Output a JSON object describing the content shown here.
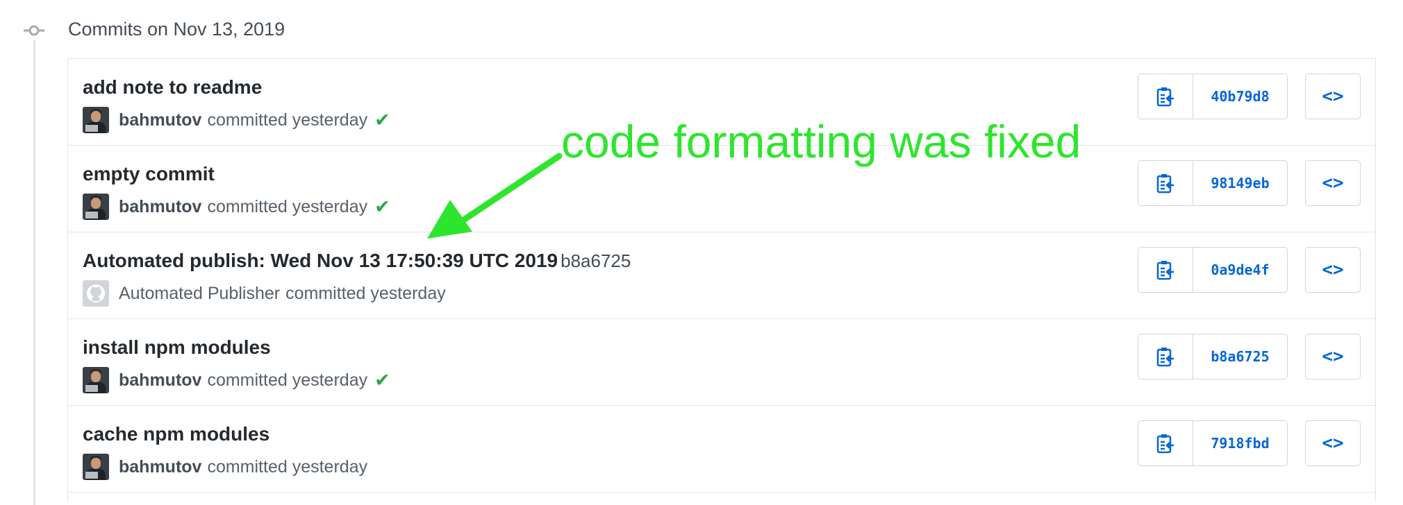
{
  "group": {
    "title": "Commits on Nov 13, 2019"
  },
  "commits": [
    {
      "title": "add note to readme",
      "title_sha": "",
      "author": "bahmutov",
      "action": "committed yesterday",
      "verified": true,
      "sha": "40b79d8",
      "avatar": "user"
    },
    {
      "title": "empty commit",
      "title_sha": "",
      "author": "bahmutov",
      "action": "committed yesterday",
      "verified": true,
      "sha": "98149eb",
      "avatar": "user"
    },
    {
      "title": "Automated publish: Wed Nov 13 17:50:39 UTC 2019",
      "title_sha": "b8a6725",
      "author": "Automated Publisher",
      "action": "committed yesterday",
      "verified": false,
      "sha": "0a9de4f",
      "avatar": "bot"
    },
    {
      "title": "install npm modules",
      "title_sha": "",
      "author": "bahmutov",
      "action": "committed yesterday",
      "verified": true,
      "sha": "b8a6725",
      "avatar": "user"
    },
    {
      "title": "cache npm modules",
      "title_sha": "",
      "author": "bahmutov",
      "action": "committed yesterday",
      "verified": false,
      "sha": "7918fbd",
      "avatar": "user"
    }
  ],
  "buttons": {
    "copy_icon": "clippy-icon",
    "browse_icon": "code-icon",
    "browse_label": "<>",
    "check_icon": "check-icon"
  },
  "annotation": {
    "text": "code formatting was fixed",
    "color": "#2ee52e"
  },
  "colors": {
    "link": "#0366d6",
    "success": "#28a745"
  }
}
